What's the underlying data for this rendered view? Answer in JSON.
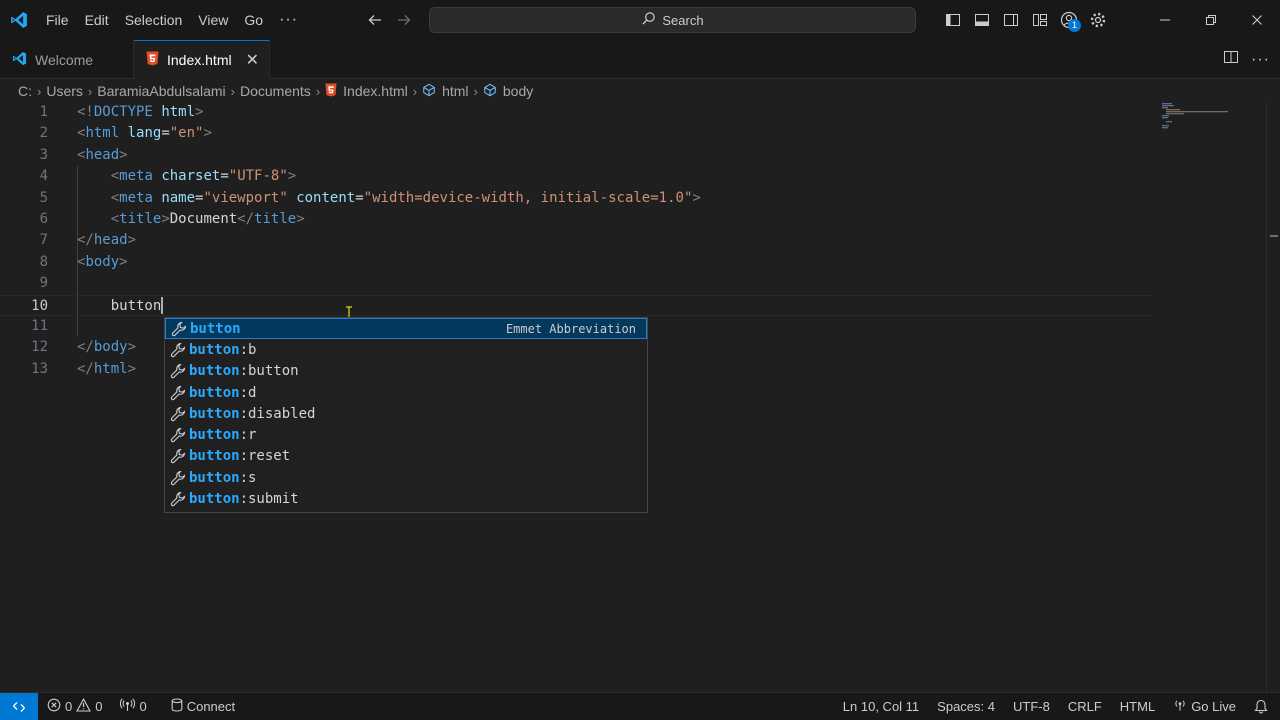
{
  "titlebar": {
    "menu": [
      "File",
      "Edit",
      "Selection",
      "View",
      "Go"
    ],
    "more": "···",
    "search_label": "Search",
    "notification_count": "1"
  },
  "tabs": [
    {
      "label": "Welcome",
      "icon": "vscode-logo-icon",
      "active": false
    },
    {
      "label": "Index.html",
      "icon": "html5-icon",
      "active": true,
      "close": "✕"
    }
  ],
  "breadcrumb": [
    "C:",
    "Users",
    "BaramiaAbdulsalami",
    "Documents",
    "Index.html",
    "html",
    "body"
  ],
  "editor": {
    "line_numbers": [
      "1",
      "2",
      "3",
      "4",
      "5",
      "6",
      "7",
      "8",
      "9",
      "10",
      "11",
      "12",
      "13"
    ],
    "current_line": "10",
    "typed": "button"
  },
  "suggest": {
    "detail": "Emmet Abbreviation",
    "match": "button",
    "items": [
      {
        "prefix": "button",
        "rest": ""
      },
      {
        "prefix": "button",
        "rest": ":b"
      },
      {
        "prefix": "button",
        "rest": ":button"
      },
      {
        "prefix": "button",
        "rest": ":d"
      },
      {
        "prefix": "button",
        "rest": ":disabled"
      },
      {
        "prefix": "button",
        "rest": ":r"
      },
      {
        "prefix": "button",
        "rest": ":reset"
      },
      {
        "prefix": "button",
        "rest": ":s"
      },
      {
        "prefix": "button",
        "rest": ":submit"
      }
    ]
  },
  "statusbar": {
    "errors": "0",
    "warnings": "0",
    "ports": "0",
    "connect": "Connect",
    "position": "Ln 10, Col 11",
    "spaces": "Spaces: 4",
    "encoding": "UTF-8",
    "eol": "CRLF",
    "language": "HTML",
    "golive": "Go Live"
  },
  "colors": {
    "accent": "#0078d4",
    "tag": "#569cd6",
    "attribute": "#9cdcfe",
    "string": "#ce9178",
    "match_highlight": "#2aaaff"
  }
}
